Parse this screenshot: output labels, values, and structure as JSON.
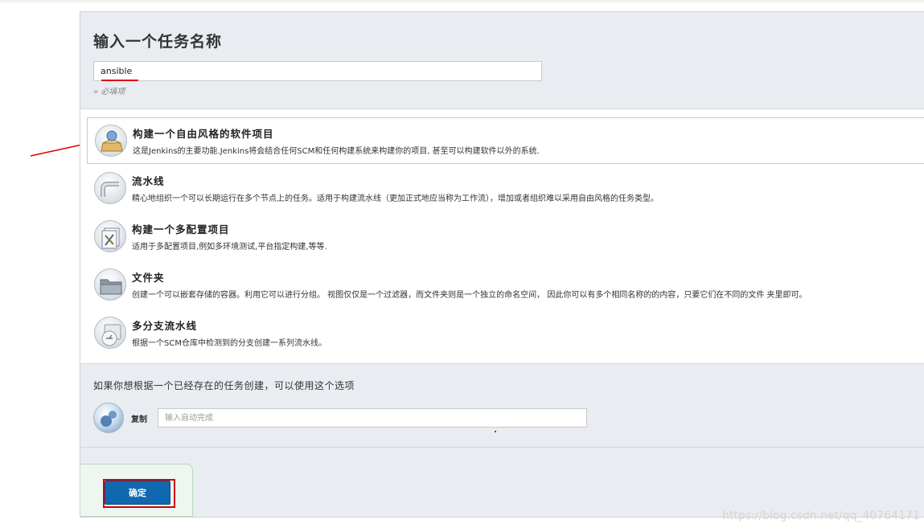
{
  "header": {
    "title": "输入一个任务名称",
    "name_value": "ansible",
    "required_hint": "» 必填项"
  },
  "item_types": [
    {
      "label": "构建一个自由风格的软件项目",
      "description": "这是Jenkins的主要功能.Jenkins将会结合任何SCM和任何构建系统来构建你的项目, 甚至可以构建软件以外的系统.",
      "icon": "freestyle-project-icon",
      "selected": true
    },
    {
      "label": "流水线",
      "description": "精心地组织一个可以长期运行在多个节点上的任务。适用于构建流水线（更加正式地应当称为工作流），增加或者组织难以采用自由风格的任务类型。",
      "icon": "pipeline-icon",
      "selected": false
    },
    {
      "label": "构建一个多配置项目",
      "description": "适用于多配置项目,例如多环境测试,平台指定构建,等等.",
      "icon": "multi-config-icon",
      "selected": false
    },
    {
      "label": "文件夹",
      "description": "创建一个可以嵌套存储的容器。利用它可以进行分组。 视图仅仅是一个过滤器，而文件夹则是一个独立的命名空间， 因此你可以有多个相同名称的的内容，只要它们在不同的文件 夹里即可。",
      "icon": "folder-icon",
      "selected": false
    },
    {
      "label": "多分支流水线",
      "description": "根据一个SCM仓库中检测到的分支创建一系列流水线。",
      "icon": "multibranch-pipeline-icon",
      "selected": false
    }
  ],
  "copy": {
    "title": "如果你想根据一个已经存在的任务创建，可以使用这个选项",
    "label": "复制",
    "placeholder": "输入自动完成"
  },
  "ok_button": {
    "label": "确定"
  },
  "watermark": "https://blog.csdn.net/qq_40764171",
  "colors": {
    "ok_button": "#1069ae",
    "annotation_red": "#e00000",
    "panel_bg": "#e9edf1"
  }
}
